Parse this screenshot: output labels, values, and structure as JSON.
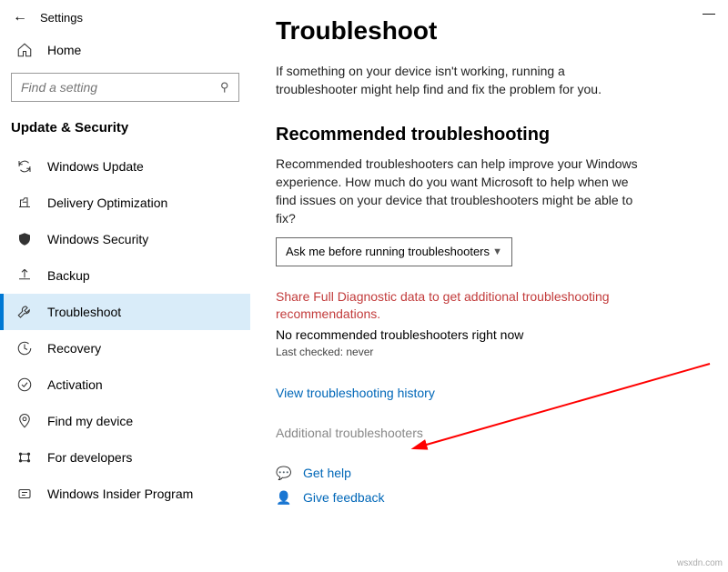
{
  "app": {
    "title": "Settings"
  },
  "sidebar": {
    "home": "Home",
    "search_placeholder": "Find a setting",
    "section": "Update & Security",
    "items": [
      {
        "label": "Windows Update"
      },
      {
        "label": "Delivery Optimization"
      },
      {
        "label": "Windows Security"
      },
      {
        "label": "Backup"
      },
      {
        "label": "Troubleshoot"
      },
      {
        "label": "Recovery"
      },
      {
        "label": "Activation"
      },
      {
        "label": "Find my device"
      },
      {
        "label": "For developers"
      },
      {
        "label": "Windows Insider Program"
      }
    ]
  },
  "main": {
    "title": "Troubleshoot",
    "intro": "If something on your device isn't working, running a troubleshooter might help find and fix the problem for you.",
    "rec_heading": "Recommended troubleshooting",
    "rec_desc": "Recommended troubleshooters can help improve your Windows experience. How much do you want Microsoft to help when we find issues on your device that troubleshooters might be able to fix?",
    "dropdown_value": "Ask me before running troubleshooters",
    "diag_link": "Share Full Diagnostic data to get additional troubleshooting recommendations.",
    "no_rec": "No recommended troubleshooters right now",
    "last_checked": "Last checked: never",
    "history_link": "View troubleshooting history",
    "additional": "Additional troubleshooters",
    "get_help": "Get help",
    "give_feedback": "Give feedback"
  },
  "watermark": "wsxdn.com"
}
